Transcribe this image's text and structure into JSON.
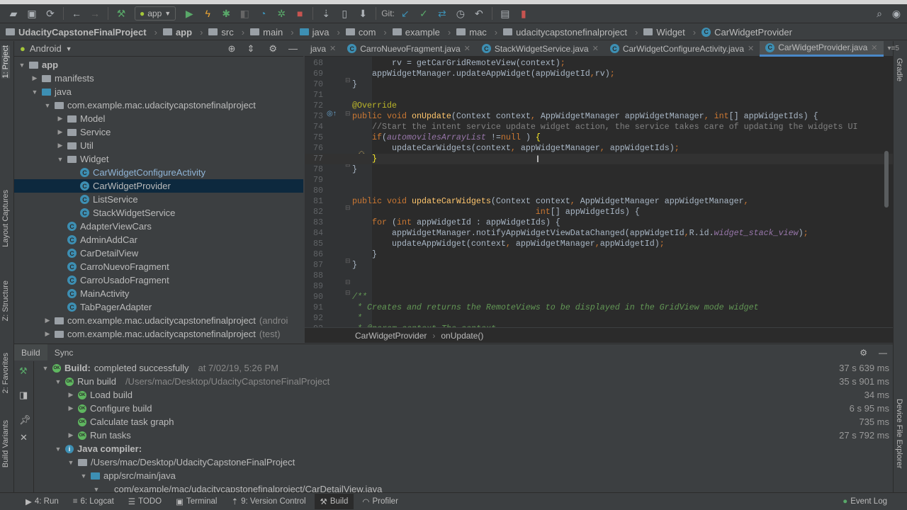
{
  "toolbar": {
    "run_config": "app",
    "git_label": "Git:"
  },
  "breadcrumbs": [
    "UdacityCapstoneFinalProject",
    "app",
    "src",
    "main",
    "java",
    "com",
    "example",
    "mac",
    "udacitycapstonefinalproject",
    "Widget",
    "CarWidgetProvider"
  ],
  "left_stripe": [
    "1: Project",
    "Layout Captures",
    "Z: Structure",
    "2: Favorites",
    "Build Variants"
  ],
  "right_stripe": [
    "Gradle",
    "Device File Explorer"
  ],
  "project": {
    "view": "Android",
    "tree": [
      {
        "label": "app",
        "depth": 0,
        "arrow": "▼",
        "icon": "folder",
        "bold": true
      },
      {
        "label": "manifests",
        "depth": 1,
        "arrow": "▶",
        "icon": "folder"
      },
      {
        "label": "java",
        "depth": 1,
        "arrow": "▼",
        "icon": "folder-blue"
      },
      {
        "label": "com.example.mac.udacitycapstonefinalproject",
        "depth": 2,
        "arrow": "▼",
        "icon": "package"
      },
      {
        "label": "Model",
        "depth": 3,
        "arrow": "▶",
        "icon": "package"
      },
      {
        "label": "Service",
        "depth": 3,
        "arrow": "▶",
        "icon": "package"
      },
      {
        "label": "Util",
        "depth": 3,
        "arrow": "▶",
        "icon": "package"
      },
      {
        "label": "Widget",
        "depth": 3,
        "arrow": "▼",
        "icon": "package"
      },
      {
        "label": "CarWidgetConfigureActivity",
        "depth": 4,
        "arrow": "",
        "icon": "class",
        "color": "#8fb4d6"
      },
      {
        "label": "CarWidgetProvider",
        "depth": 4,
        "arrow": "",
        "icon": "class",
        "selected": true
      },
      {
        "label": "ListService",
        "depth": 4,
        "arrow": "",
        "icon": "class"
      },
      {
        "label": "StackWidgetService",
        "depth": 4,
        "arrow": "",
        "icon": "class"
      },
      {
        "label": "AdapterViewCars",
        "depth": 3,
        "arrow": "",
        "icon": "class"
      },
      {
        "label": "AdminAddCar",
        "depth": 3,
        "arrow": "",
        "icon": "class"
      },
      {
        "label": "CarDetailView",
        "depth": 3,
        "arrow": "",
        "icon": "class"
      },
      {
        "label": "CarroNuevoFragment",
        "depth": 3,
        "arrow": "",
        "icon": "class"
      },
      {
        "label": "CarroUsadoFragment",
        "depth": 3,
        "arrow": "",
        "icon": "class"
      },
      {
        "label": "MainActivity",
        "depth": 3,
        "arrow": "",
        "icon": "class"
      },
      {
        "label": "TabPagerAdapter",
        "depth": 3,
        "arrow": "",
        "icon": "class"
      },
      {
        "label": "com.example.mac.udacitycapstonefinalproject",
        "suffix": "(androi",
        "depth": 2,
        "arrow": "▶",
        "icon": "package"
      },
      {
        "label": "com.example.mac.udacitycapstonefinalproject",
        "suffix": "(test)",
        "depth": 2,
        "arrow": "▶",
        "icon": "package"
      }
    ]
  },
  "editor": {
    "tabs": [
      {
        "label": "java",
        "active": false
      },
      {
        "label": "CarroNuevoFragment.java"
      },
      {
        "label": "StackWidgetService.java"
      },
      {
        "label": "CarWidgetConfigureActivity.java"
      },
      {
        "label": "CarWidgetProvider.java",
        "active": true
      }
    ],
    "tab_overflow": "5",
    "lines": [
      {
        "n": "68",
        "s": [
          [
            "",
            "        rv = getCarGridRemoteView(context)"
          ],
          [
            "kw",
            ";"
          ]
        ]
      },
      {
        "n": "69",
        "s": [
          [
            "",
            "    appWidgetManager.updateAppWidget(appWidgetId"
          ],
          [
            "kw",
            ","
          ],
          [
            "",
            "rv)"
          ],
          [
            "kw",
            ";"
          ]
        ]
      },
      {
        "n": "70",
        "s": [
          [
            "",
            "}"
          ]
        ]
      },
      {
        "n": "71",
        "s": []
      },
      {
        "n": "72",
        "s": [
          [
            "an",
            "@Override"
          ]
        ]
      },
      {
        "n": "73",
        "s": [
          [
            "kw",
            "public void "
          ],
          [
            "fn",
            "onUpdate"
          ],
          [
            "",
            "(Context context"
          ],
          [
            "kw",
            ", "
          ],
          [
            "",
            "AppWidgetManager appWidgetManager"
          ],
          [
            "kw",
            ", int"
          ],
          [
            "",
            "[] appWidgetIds) {"
          ]
        ]
      },
      {
        "n": "74",
        "s": [
          [
            "cm",
            "    //Start the intent service update widget action, the service takes care of updating the widgets UI"
          ]
        ]
      },
      {
        "n": "75",
        "s": [
          [
            "kw",
            "    if"
          ],
          [
            "",
            "("
          ],
          [
            "pu",
            "automovilesArrayList"
          ],
          [
            "",
            " !="
          ],
          [
            "kw",
            "null"
          ],
          [
            "",
            " ) "
          ],
          [
            "br",
            "{"
          ]
        ]
      },
      {
        "n": "76",
        "s": [
          [
            "",
            "        updateCarWidgets(context"
          ],
          [
            "kw",
            ", "
          ],
          [
            "",
            "appWidgetManager"
          ],
          [
            "kw",
            ", "
          ],
          [
            "",
            "appWidgetIds)"
          ],
          [
            "kw",
            ";"
          ]
        ]
      },
      {
        "n": "77",
        "s": [
          [
            "",
            "    "
          ],
          [
            "br",
            "}"
          ]
        ],
        "current": true
      },
      {
        "n": "78",
        "s": [
          [
            "",
            "}"
          ]
        ]
      },
      {
        "n": "79",
        "s": []
      },
      {
        "n": "80",
        "s": []
      },
      {
        "n": "81",
        "s": [
          [
            "kw",
            "public void "
          ],
          [
            "fn",
            "updateCarWidgets"
          ],
          [
            "",
            "(Context context"
          ],
          [
            "kw",
            ", "
          ],
          [
            "",
            "AppWidgetManager appWidgetManager"
          ],
          [
            "kw",
            ","
          ]
        ]
      },
      {
        "n": "82",
        "s": [
          [
            "kw",
            "                                     int"
          ],
          [
            "",
            "[] appWidgetIds) {"
          ]
        ]
      },
      {
        "n": "83",
        "s": [
          [
            "kw",
            "    for "
          ],
          [
            "",
            "("
          ],
          [
            "kw",
            "int "
          ],
          [
            "",
            "appWidgetId : appWidgetIds) {"
          ]
        ]
      },
      {
        "n": "84",
        "s": [
          [
            "",
            "        appWidgetManager.notifyAppWidgetViewDataChanged(appWidgetId"
          ],
          [
            "kw",
            ","
          ],
          [
            "",
            "R.id."
          ],
          [
            "pu",
            "widget_stack_view"
          ],
          [
            "",
            ")"
          ],
          [
            "kw",
            ";"
          ]
        ]
      },
      {
        "n": "85",
        "s": [
          [
            "",
            "        updateAppWidget(context"
          ],
          [
            "kw",
            ", "
          ],
          [
            "",
            "appWidgetManager"
          ],
          [
            "kw",
            ","
          ],
          [
            "",
            "appWidgetId)"
          ],
          [
            "kw",
            ";"
          ]
        ]
      },
      {
        "n": "86",
        "s": [
          [
            "",
            "    }"
          ]
        ]
      },
      {
        "n": "87",
        "s": [
          [
            "",
            "}"
          ]
        ]
      },
      {
        "n": "88",
        "s": []
      },
      {
        "n": "89",
        "s": []
      },
      {
        "n": "90",
        "s": [
          [
            "jd",
            "/**"
          ]
        ]
      },
      {
        "n": "91",
        "s": [
          [
            "jd",
            " * Creates and returns the RemoteViews to be displayed in the GridView mode widget"
          ]
        ]
      },
      {
        "n": "92",
        "s": [
          [
            "jd",
            " *"
          ]
        ]
      },
      {
        "n": "93",
        "s": [
          [
            "jd",
            " * @param context The context"
          ]
        ]
      }
    ],
    "breadcrumb": [
      "CarWidgetProvider",
      "onUpdate()"
    ]
  },
  "build": {
    "tabs": [
      "Build",
      "Sync"
    ],
    "rows": [
      {
        "depth": 0,
        "arrow": "▼",
        "icon": "ok",
        "label": "Build:",
        "rest": " completed successfully",
        "muted": "at 7/02/19, 5:26 PM",
        "time": "37 s 639 ms",
        "bold": true
      },
      {
        "depth": 1,
        "arrow": "▼",
        "icon": "ok",
        "label": "Run build",
        "muted": "/Users/mac/Desktop/UdacityCapstoneFinalProject",
        "time": "35 s 901 ms"
      },
      {
        "depth": 2,
        "arrow": "▶",
        "icon": "ok",
        "label": "Load build",
        "time": "34 ms"
      },
      {
        "depth": 2,
        "arrow": "▶",
        "icon": "ok",
        "label": "Configure build",
        "time": "6 s 95 ms"
      },
      {
        "depth": 2,
        "arrow": "",
        "icon": "ok",
        "label": "Calculate task graph",
        "time": "735 ms"
      },
      {
        "depth": 2,
        "arrow": "▶",
        "icon": "ok",
        "label": "Run tasks",
        "time": "27 s 792 ms"
      },
      {
        "depth": 1,
        "arrow": "▼",
        "icon": "info",
        "label": "Java compiler:",
        "bold": true
      },
      {
        "depth": 2,
        "arrow": "▼",
        "icon": "module",
        "label": "/Users/mac/Desktop/UdacityCapstoneFinalProject"
      },
      {
        "depth": 3,
        "arrow": "▼",
        "icon": "folder-blue",
        "label": "app/src/main/java"
      },
      {
        "depth": 4,
        "arrow": "▼",
        "icon": "file",
        "label": "com/example/mac/udacitycapstonefinalproject/CarDetailView.java"
      }
    ]
  },
  "status_bar": {
    "items": [
      {
        "label": "4: Run"
      },
      {
        "label": "6: Logcat"
      },
      {
        "label": "TODO"
      },
      {
        "label": "Terminal"
      },
      {
        "label": "9: Version Control"
      },
      {
        "label": "Build",
        "active": true
      },
      {
        "label": "Profiler"
      }
    ],
    "event_log": "Event Log"
  }
}
